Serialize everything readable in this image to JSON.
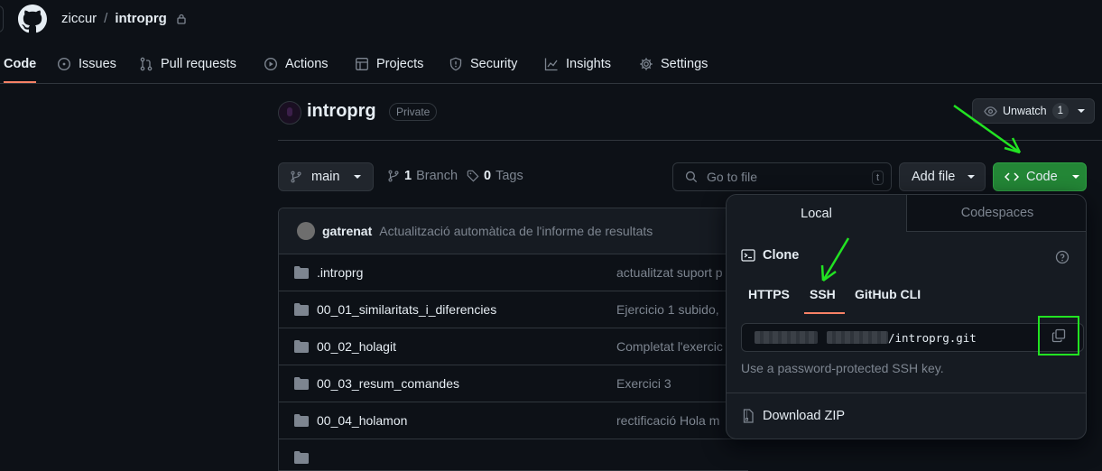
{
  "header": {
    "owner": "ziccur",
    "separator": "/",
    "repo": "introprg"
  },
  "nav": {
    "items": [
      {
        "label": "Code",
        "icon": "code-icon",
        "active": true
      },
      {
        "label": "Issues",
        "icon": "issue-icon"
      },
      {
        "label": "Pull requests",
        "icon": "pull-request-icon"
      },
      {
        "label": "Actions",
        "icon": "actions-play-icon"
      },
      {
        "label": "Projects",
        "icon": "table-icon"
      },
      {
        "label": "Security",
        "icon": "shield-icon"
      },
      {
        "label": "Insights",
        "icon": "graph-icon"
      },
      {
        "label": "Settings",
        "icon": "gear-icon"
      }
    ]
  },
  "repo": {
    "name": "introprg",
    "visibility": "Private",
    "unwatch_label": "Unwatch",
    "watch_count": "1"
  },
  "toolbar": {
    "branch": "main",
    "branch_count": "1",
    "branch_label": "Branch",
    "tag_count": "0",
    "tag_label": "Tags",
    "search_placeholder": "Go to file",
    "search_shortcut": "t",
    "add_file_label": "Add file",
    "code_label": "Code"
  },
  "commit": {
    "user": "gatrenat",
    "message": "Actualització automàtica de l'informe de resultats"
  },
  "files": [
    {
      "name": ".introprg",
      "message": "actualitzat suport p"
    },
    {
      "name": "00_01_similaritats_i_diferencies",
      "message": "Ejercicio 1 subido,"
    },
    {
      "name": "00_02_holagit",
      "message": "Completat l'exercic"
    },
    {
      "name": "00_03_resum_comandes",
      "message": "Exercici 3"
    },
    {
      "name": "00_04_holamon",
      "message": "rectificació Hola m"
    }
  ],
  "clone_panel": {
    "tabs": [
      "Local",
      "Codespaces"
    ],
    "title": "Clone",
    "protocols": [
      "HTTPS",
      "SSH",
      "GitHub CLI"
    ],
    "active_protocol": "SSH",
    "url_visible": "/introprg.git",
    "hint": "Use a password-protected SSH key.",
    "download_label": "Download ZIP"
  },
  "colors": {
    "background": "#0d1117",
    "accent_underline": "#f78166",
    "code_button": "#238636",
    "annotation": "#22e322"
  }
}
